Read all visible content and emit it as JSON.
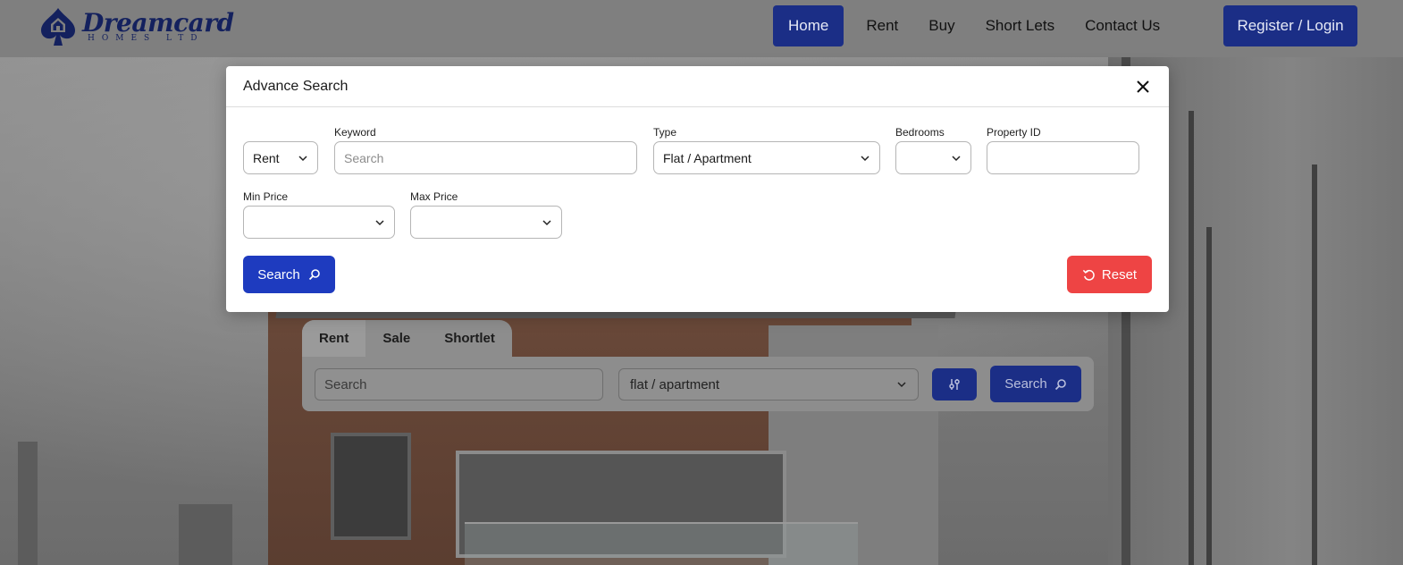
{
  "brand": {
    "name": "Dreamcard",
    "subtitle": "HOMES LTD"
  },
  "nav": {
    "items": [
      {
        "label": "Home",
        "active": true
      },
      {
        "label": "Rent"
      },
      {
        "label": "Buy"
      },
      {
        "label": "Short Lets"
      },
      {
        "label": "Contact Us"
      }
    ],
    "login_label": "Register / Login"
  },
  "search_panel": {
    "tabs": [
      {
        "label": "Rent",
        "active": true
      },
      {
        "label": "Sale"
      },
      {
        "label": "Shortlet"
      }
    ],
    "keyword_placeholder": "Search",
    "type_value": "flat / apartment",
    "filter_icon": "sliders-icon",
    "search_label": "Search"
  },
  "modal": {
    "title": "Advance Search",
    "close_icon": "close-icon",
    "listing_select": {
      "value": "Rent"
    },
    "keyword": {
      "label": "Keyword",
      "placeholder": "Search",
      "value": ""
    },
    "type": {
      "label": "Type",
      "value": "Flat / Apartment"
    },
    "bedrooms": {
      "label": "Bedrooms",
      "value": ""
    },
    "property_id": {
      "label": "Property ID",
      "value": ""
    },
    "min_price": {
      "label": "Min Price",
      "value": ""
    },
    "max_price": {
      "label": "Max Price",
      "value": ""
    },
    "search_label": "Search",
    "reset_label": "Reset"
  },
  "colors": {
    "primary": "#1e3bbf",
    "nav_active": "#1b2e86",
    "danger": "#ee4444",
    "brand_text": "#14215e"
  }
}
